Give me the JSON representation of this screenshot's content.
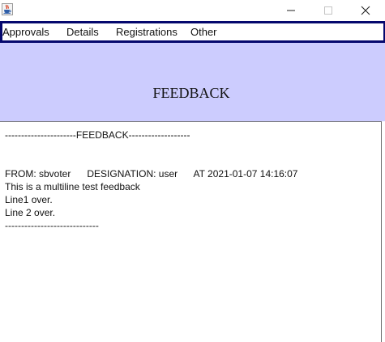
{
  "window": {
    "icon": "java-cup-icon",
    "controls": {
      "minimize_icon": "minimize-icon",
      "maximize_icon": "maximize-icon",
      "close_icon": "close-icon"
    }
  },
  "menu": {
    "items": [
      {
        "label": "Approvals"
      },
      {
        "label": "Details"
      },
      {
        "label": "Registrations"
      },
      {
        "label": "Other"
      }
    ]
  },
  "header": {
    "title": "FEEDBACK",
    "background": "#ccccfe"
  },
  "feedback": {
    "lines": [
      "----------------------FEEDBACK-------------------",
      "FROM: sbvoter      DESIGNATION: user      AT 2021-01-07 14:16:07",
      "This is a multiline test feedback",
      "Line1 over.",
      "Line 2 over.",
      "-----------------------------"
    ]
  },
  "colors": {
    "menu_border": "#05086e",
    "header_band": "#ccccfe"
  }
}
